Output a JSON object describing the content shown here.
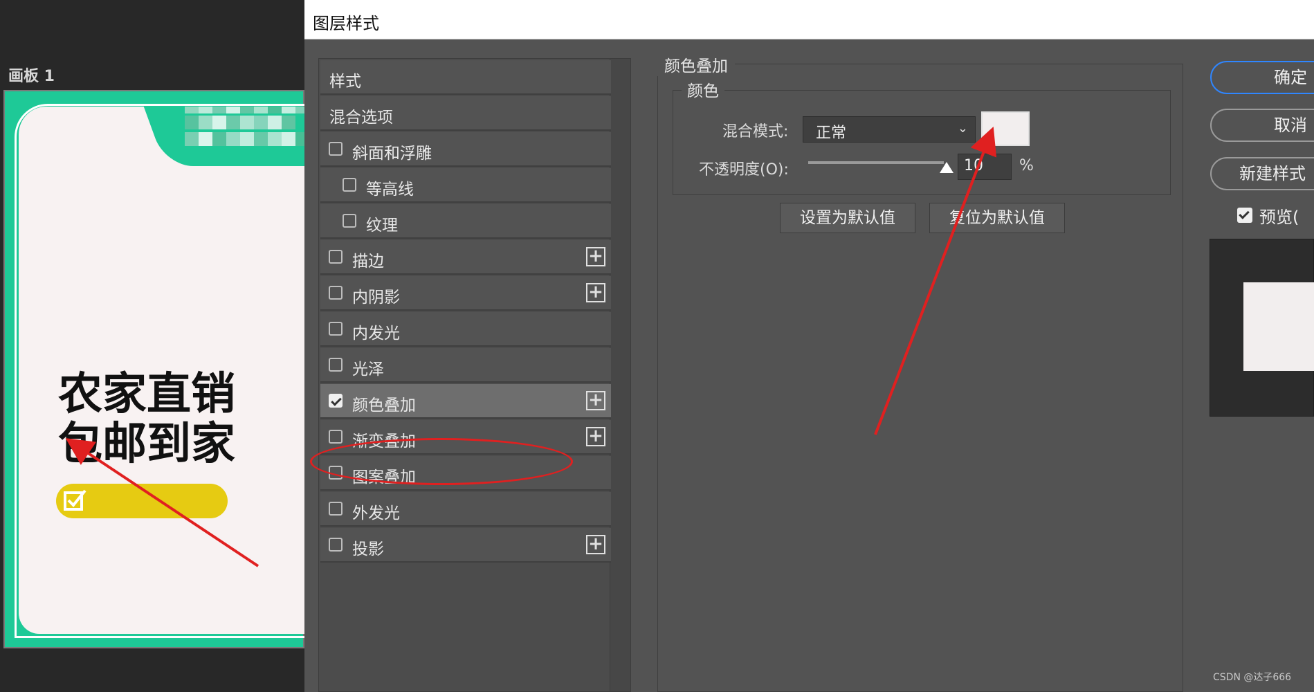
{
  "artboard": {
    "label": "画板 1",
    "headline_line1": "农家直销",
    "headline_line2": "包邮到家"
  },
  "dialog": {
    "title": "图层样式",
    "styles_list": [
      {
        "label": "样式",
        "type": "header"
      },
      {
        "label": "混合选项",
        "type": "header"
      },
      {
        "label": "斜面和浮雕",
        "type": "checkbox",
        "checked": false
      },
      {
        "label": "等高线",
        "type": "checkbox",
        "checked": false
      },
      {
        "label": "纹理",
        "type": "checkbox",
        "checked": false
      },
      {
        "label": "描边",
        "type": "checkbox",
        "checked": false,
        "add": true
      },
      {
        "label": "内阴影",
        "type": "checkbox",
        "checked": false,
        "add": true
      },
      {
        "label": "内发光",
        "type": "checkbox",
        "checked": false
      },
      {
        "label": "光泽",
        "type": "checkbox",
        "checked": false
      },
      {
        "label": "颜色叠加",
        "type": "checkbox",
        "checked": true,
        "add": true,
        "selected": true
      },
      {
        "label": "渐变叠加",
        "type": "checkbox",
        "checked": false,
        "add": true
      },
      {
        "label": "图案叠加",
        "type": "checkbox",
        "checked": false
      },
      {
        "label": "外发光",
        "type": "checkbox",
        "checked": false
      },
      {
        "label": "投影",
        "type": "checkbox",
        "checked": false,
        "add": true
      }
    ],
    "panel": {
      "title": "颜色叠加",
      "group_title": "颜色",
      "blend_mode_label": "混合模式:",
      "blend_mode_value": "正常",
      "overlay_color": "#f2eeee",
      "opacity_label": "不透明度(O):",
      "opacity_value": "10",
      "opacity_unit": "%",
      "set_default": "设置为默认值",
      "reset_default": "复位为默认值"
    },
    "side": {
      "ok": "确定",
      "cancel": "取消",
      "new_style": "新建样式",
      "preview": "预览("
    }
  },
  "watermark": "CSDN @达子666",
  "colors": {
    "accent_green": "#1ec997",
    "pill_yellow": "#e6cb12",
    "annotation_red": "#e02020"
  }
}
